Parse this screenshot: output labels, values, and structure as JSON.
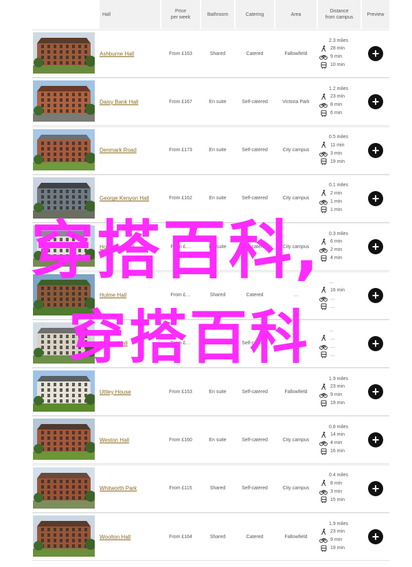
{
  "header": {
    "hall": "Hall",
    "price": "Price\nper week",
    "bathroom": "Bathroom",
    "catering": "Catering",
    "area": "Area",
    "distance": "Distance\nfrom campus",
    "preview": "Preview"
  },
  "rows": [
    {
      "name": "Ashburne Hall",
      "price": "From £163",
      "bathroom": "Shared",
      "catering": "Catered",
      "area": "Fallowfield",
      "miles": "2.3 miles",
      "walk": "28 min",
      "bike": "9 min",
      "bus": "10 min",
      "photo": "brick-old-house"
    },
    {
      "name": "Daisy Bank Hall",
      "price": "From £167",
      "bathroom": "En suite",
      "catering": "Self-catered",
      "area": "Victoria Park",
      "miles": "1.2 miles",
      "walk": "23 min",
      "bike": "8 min",
      "bus": "6 min",
      "photo": "brick-block"
    },
    {
      "name": "Denmark Road",
      "price": "From £173",
      "bathroom": "En suite",
      "catering": "Self-catered",
      "area": "City campus",
      "miles": "0.5 miles",
      "walk": "11 min",
      "bike": "3 min",
      "bus": "19 min",
      "photo": "brick-courtyard"
    },
    {
      "name": "George Kenyon Hall",
      "price": "From £162",
      "bathroom": "En suite",
      "catering": "Self-catered",
      "area": "City campus",
      "miles": "0.1 miles",
      "walk": "2 min",
      "bike": "1 min",
      "bus": "1 min",
      "photo": "tower-block"
    },
    {
      "name": "Horniman Hall",
      "price": "From £…",
      "bathroom": "En suite",
      "catering": "Self-catered",
      "area": "City campus",
      "miles": "0.3 miles",
      "walk": "6 min",
      "bike": "2 min",
      "bus": "4 min",
      "photo": "white-modern"
    },
    {
      "name": "Hulme Hall",
      "price": "From £…",
      "bathroom": "Shared",
      "catering": "Catered",
      "area": "…",
      "miles": "…",
      "walk": "16 min",
      "bike": "…",
      "bus": "…",
      "photo": "green-trees"
    },
    {
      "name": "Ansum Hall",
      "price": "From £…",
      "bathroom": "Shared",
      "catering": "Self-catered",
      "area": "…",
      "miles": "…",
      "walk": "…",
      "bike": "…",
      "bus": "…",
      "photo": "white-house"
    },
    {
      "name": "Uttley House",
      "price": "From £153",
      "bathroom": "En suite",
      "catering": "Self-catered",
      "area": "Fallowfield",
      "miles": "1.9 miles",
      "walk": "23 min",
      "bike": "9 min",
      "bus": "19 min",
      "photo": "white-villa"
    },
    {
      "name": "Weston Hall",
      "price": "From £160",
      "bathroom": "En suite",
      "catering": "Self-catered",
      "area": "City campus",
      "miles": "0.8 miles",
      "walk": "14 min",
      "bike": "4 min",
      "bus": "16 min",
      "photo": "brick-lawn"
    },
    {
      "name": "Whitworth Park",
      "price": "From £115",
      "bathroom": "Shared",
      "catering": "Self-catered",
      "area": "City campus",
      "miles": "0.4 miles",
      "walk": "8 min",
      "bike": "3 min",
      "bus": "15 min",
      "photo": "brick-pyramid"
    },
    {
      "name": "Woolton Hall",
      "price": "From £164",
      "bathroom": "Shared",
      "catering": "Catered",
      "area": "Fallowfield",
      "miles": "1.9 miles",
      "walk": "23 min",
      "bike": "9 min",
      "bus": "19 min",
      "photo": "brick-long"
    }
  ],
  "overlay": {
    "line1": "穿搭百科,",
    "line2": "穿搭百科"
  },
  "colors": {
    "link": "#8a6a1f",
    "overlay": "#ff2bff",
    "header_bg": "#f1f1f1"
  }
}
